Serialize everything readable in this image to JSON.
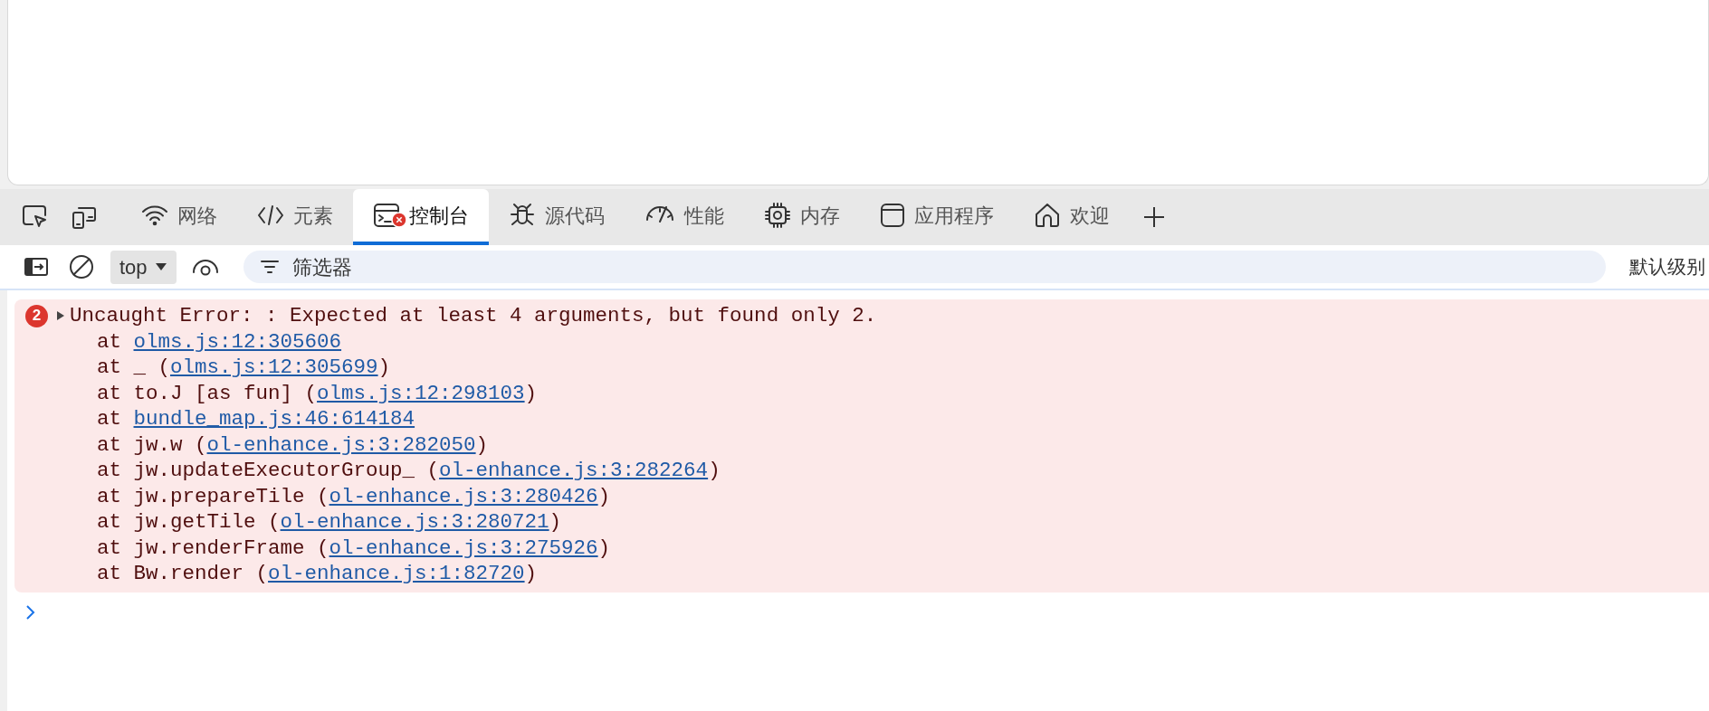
{
  "devtools_toolbar": {
    "buttons": [
      {
        "kind": "inspect"
      },
      {
        "kind": "device"
      }
    ],
    "tabs": [
      {
        "kind": "network",
        "label": "网络",
        "selected": false,
        "error_badge": false
      },
      {
        "kind": "elements",
        "label": "元素",
        "selected": false,
        "error_badge": false
      },
      {
        "kind": "console",
        "label": "控制台",
        "selected": true,
        "error_badge": true
      },
      {
        "kind": "sources",
        "label": "源代码",
        "selected": false,
        "error_badge": false
      },
      {
        "kind": "performance",
        "label": "性能",
        "selected": false,
        "error_badge": false
      },
      {
        "kind": "memory",
        "label": "内存",
        "selected": false,
        "error_badge": false
      },
      {
        "kind": "application",
        "label": "应用程序",
        "selected": false,
        "error_badge": false
      },
      {
        "kind": "welcome",
        "label": "欢迎",
        "selected": false,
        "error_badge": false
      }
    ]
  },
  "console_toolbar": {
    "context": "top",
    "filter": {
      "placeholder": "筛选器"
    },
    "levels": "默认级别"
  },
  "messages": [
    {
      "kind": "error",
      "count": "2",
      "expanded": false,
      "text": "Uncaught Error: : Expected at least 4 arguments, but found only 2.",
      "stack": [
        {
          "prefix": "at ",
          "link": "olms.js:12:305606"
        },
        {
          "prefix": "at _ (",
          "link": "olms.js:12:305699",
          "suffix": ")"
        },
        {
          "prefix": "at to.J [as fun] (",
          "link": "olms.js:12:298103",
          "suffix": ")"
        },
        {
          "prefix": "at ",
          "link": "bundle_map.js:46:614184"
        },
        {
          "prefix": "at jw.w (",
          "link": "ol-enhance.js:3:282050",
          "suffix": ")"
        },
        {
          "prefix": "at jw.updateExecutorGroup_ (",
          "link": "ol-enhance.js:3:282264",
          "suffix": ")"
        },
        {
          "prefix": "at jw.prepareTile (",
          "link": "ol-enhance.js:3:280426",
          "suffix": ")"
        },
        {
          "prefix": "at jw.getTile (",
          "link": "ol-enhance.js:3:280721",
          "suffix": ")"
        },
        {
          "prefix": "at jw.renderFrame (",
          "link": "ol-enhance.js:3:275926",
          "suffix": ")"
        },
        {
          "prefix": "at Bw.render (",
          "link": "ol-enhance.js:1:82720",
          "suffix": ")"
        }
      ]
    }
  ]
}
